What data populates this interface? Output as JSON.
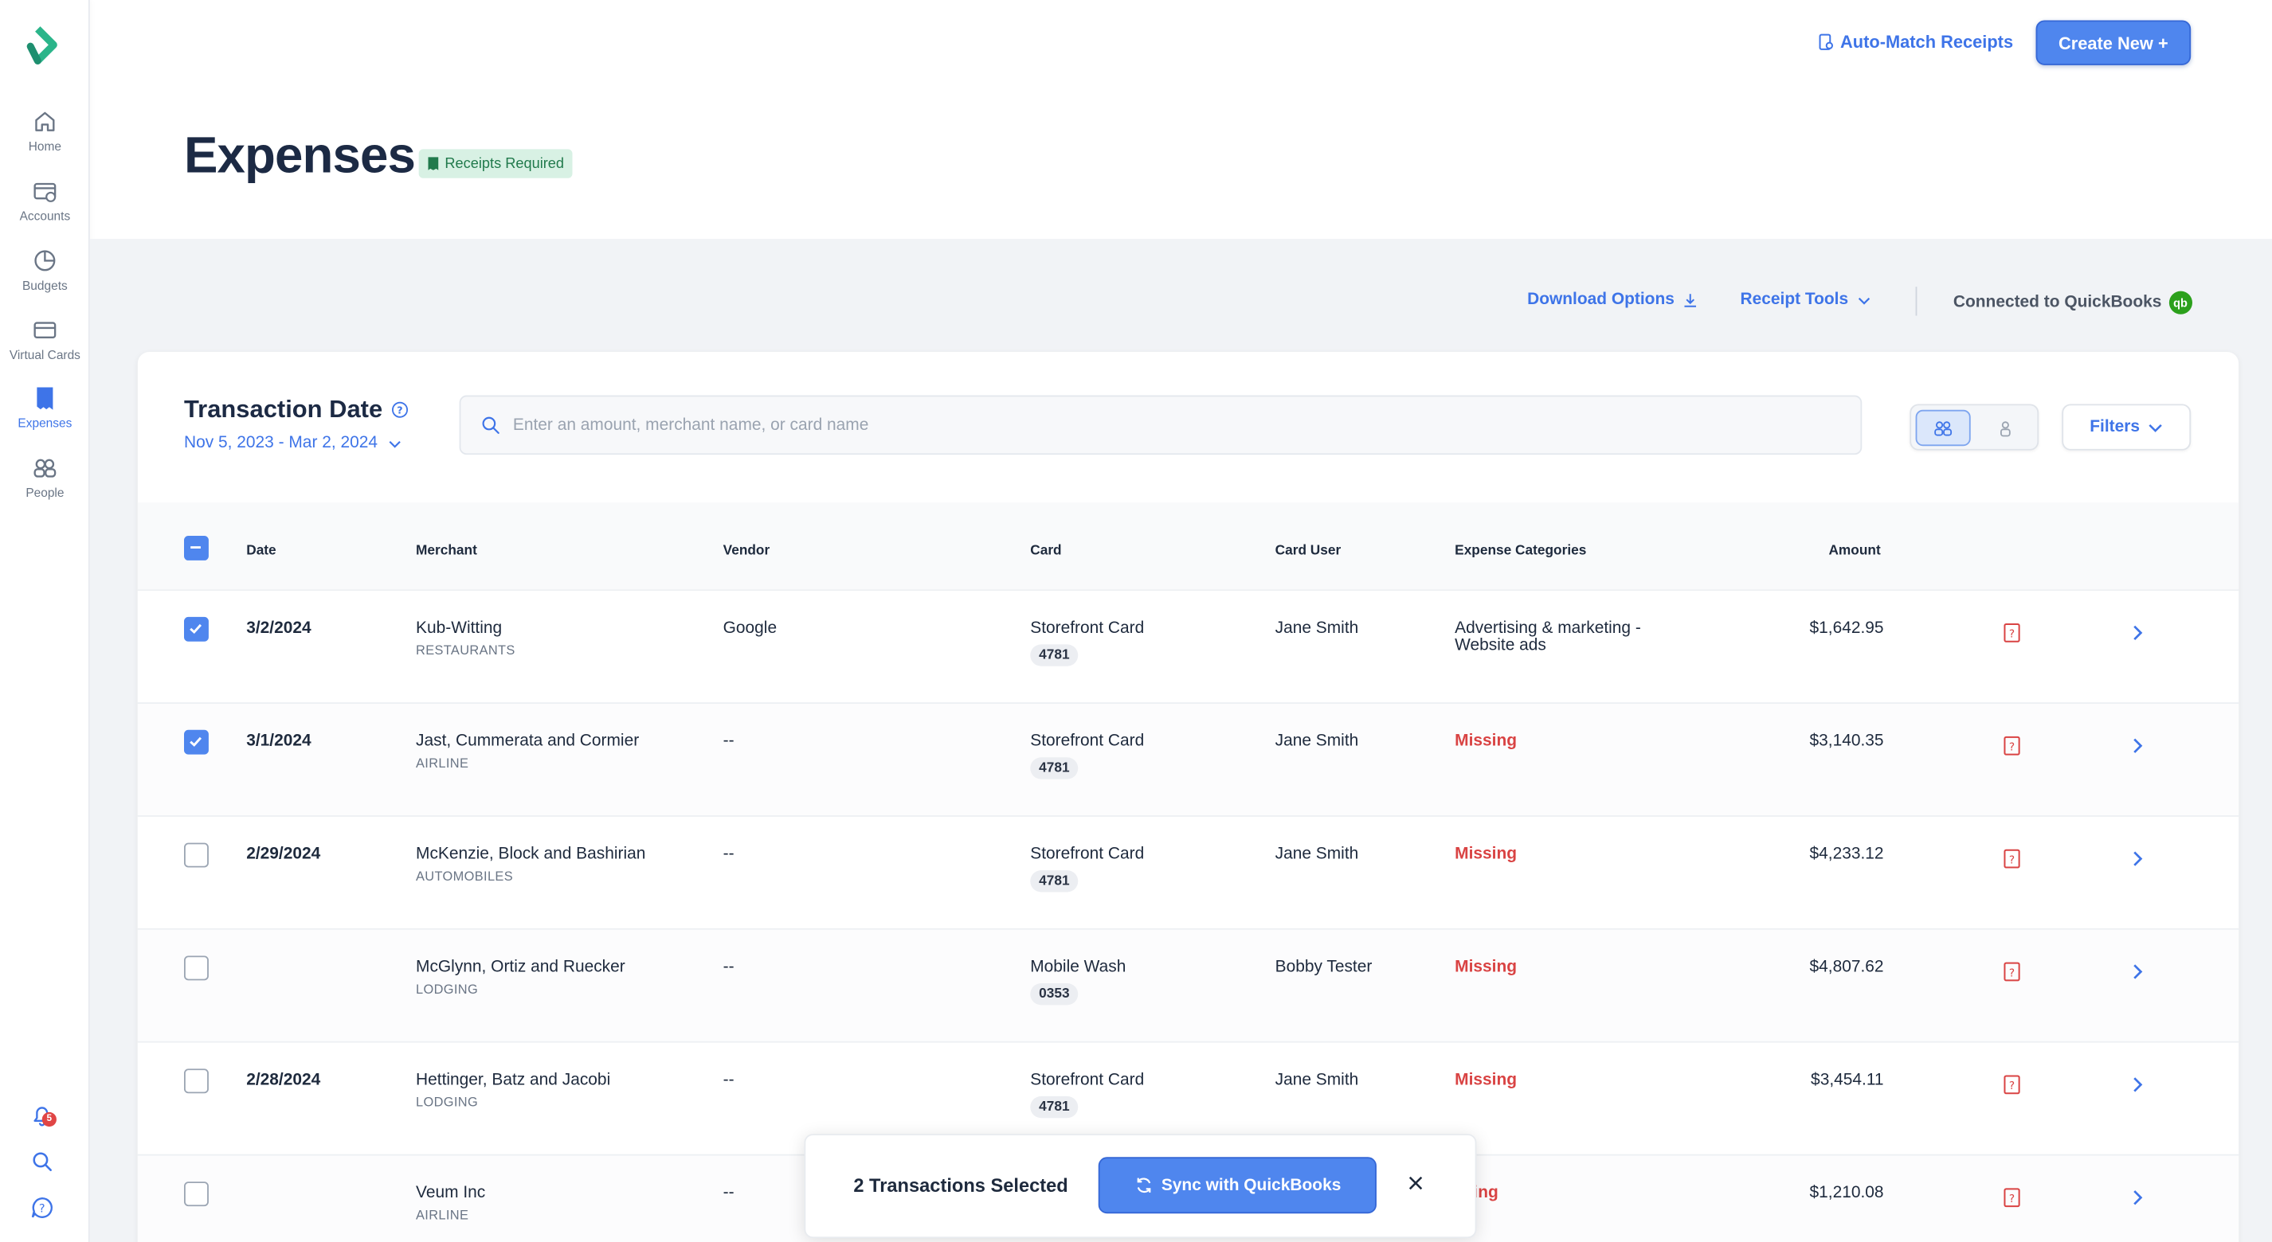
{
  "sidebar": {
    "items": [
      {
        "label": "Home",
        "icon": "home-icon"
      },
      {
        "label": "Accounts",
        "icon": "accounts-icon"
      },
      {
        "label": "Budgets",
        "icon": "budgets-icon"
      },
      {
        "label": "Virtual Cards",
        "icon": "virtual-cards-icon"
      },
      {
        "label": "Expenses",
        "icon": "expenses-icon"
      },
      {
        "label": "People",
        "icon": "people-icon"
      }
    ],
    "notifications_count": "5"
  },
  "header": {
    "auto_match_label": "Auto-Match Receipts",
    "create_new_label": "Create New +",
    "page_title": "Expenses",
    "receipts_badge": "Receipts Required"
  },
  "toolbar": {
    "download_label": "Download Options",
    "receipt_tools_label": "Receipt Tools",
    "connected_label": "Connected to QuickBooks",
    "qb_logo_text": "qb"
  },
  "filter_bar": {
    "title": "Transaction Date",
    "date_range": "Nov 5, 2023 - Mar 2, 2024",
    "search_placeholder": "Enter an amount, merchant name, or card name",
    "filters_label": "Filters"
  },
  "table": {
    "columns": [
      "Date",
      "Merchant",
      "Vendor",
      "Card",
      "Card User",
      "Expense Categories",
      "Amount"
    ],
    "rows": [
      {
        "checked": true,
        "date": "3/2/2024",
        "merchant": "Kub-Witting",
        "merchant_type": "RESTAURANTS",
        "vendor": "Google",
        "card": "Storefront Card",
        "card_num": "4781",
        "card_user": "Jane Smith",
        "category": "Advertising & marketing -",
        "category_line2": "Website ads",
        "category_missing": false,
        "amount": "$1,642.95"
      },
      {
        "checked": true,
        "date": "3/1/2024",
        "merchant": "Jast, Cummerata and Cormier",
        "merchant_type": "AIRLINE",
        "vendor": "--",
        "card": "Storefront Card",
        "card_num": "4781",
        "card_user": "Jane Smith",
        "category": "Missing",
        "category_line2": "",
        "category_missing": true,
        "amount": "$3,140.35"
      },
      {
        "checked": false,
        "date": "2/29/2024",
        "merchant": "McKenzie, Block and Bashirian",
        "merchant_type": "AUTOMOBILES",
        "vendor": "--",
        "card": "Storefront Card",
        "card_num": "4781",
        "card_user": "Jane Smith",
        "category": "Missing",
        "category_line2": "",
        "category_missing": true,
        "amount": "$4,233.12"
      },
      {
        "checked": false,
        "date": "",
        "merchant": "McGlynn, Ortiz and Ruecker",
        "merchant_type": "LODGING",
        "vendor": "--",
        "card": "Mobile Wash",
        "card_num": "0353",
        "card_user": "Bobby Tester",
        "category": "Missing",
        "category_line2": "",
        "category_missing": true,
        "amount": "$4,807.62"
      },
      {
        "checked": false,
        "date": "2/28/2024",
        "merchant": "Hettinger, Batz and Jacobi",
        "merchant_type": "LODGING",
        "vendor": "--",
        "card": "Storefront Card",
        "card_num": "4781",
        "card_user": "Jane Smith",
        "category": "Missing",
        "category_line2": "",
        "category_missing": true,
        "amount": "$3,454.11"
      },
      {
        "checked": false,
        "date": "",
        "merchant": "Veum Inc",
        "merchant_type": "AIRLINE",
        "vendor": "--",
        "card": "",
        "card_num": "",
        "card_user": "",
        "category": "ssing",
        "category_line2": "",
        "category_missing": true,
        "amount": "$1,210.08"
      }
    ]
  },
  "selection_bar": {
    "text": "2 Transactions Selected",
    "sync_label": "Sync with QuickBooks"
  },
  "colors": {
    "accent": "#4f86ee",
    "missing": "#d94343",
    "badge_bg": "#d8f1e4",
    "quickbooks": "#2ca01c"
  }
}
